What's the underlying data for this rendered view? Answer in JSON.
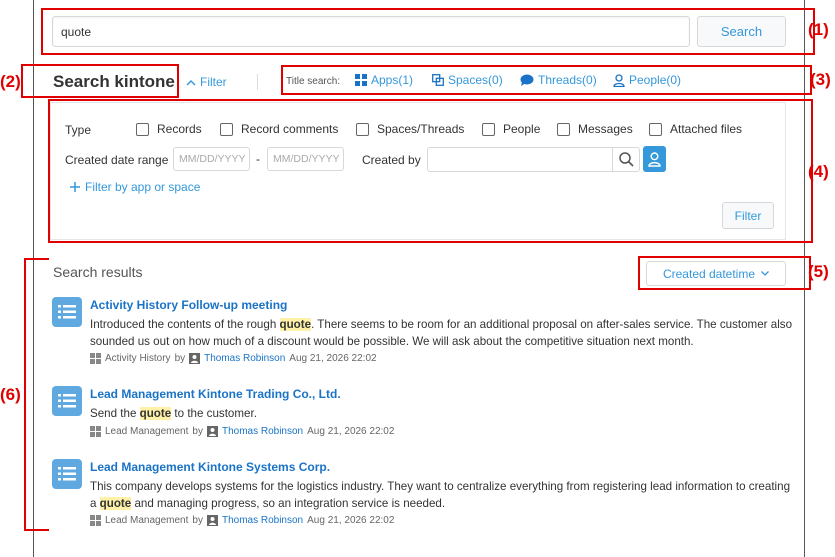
{
  "search": {
    "value": "quote",
    "button": "Search"
  },
  "header": {
    "title": "Search kintone",
    "filter_toggle": "Filter",
    "title_search_label": "Title search:",
    "links": [
      {
        "label": "Apps(1)",
        "icon": "apps-icon"
      },
      {
        "label": "Spaces(0)",
        "icon": "spaces-icon"
      },
      {
        "label": "Threads(0)",
        "icon": "threads-icon"
      },
      {
        "label": "People(0)",
        "icon": "people-icon"
      }
    ]
  },
  "filters": {
    "type_label": "Type",
    "types": [
      "Records",
      "Record comments",
      "Spaces/Threads",
      "People",
      "Messages",
      "Attached files"
    ],
    "date_label": "Created date range",
    "date_from_placeholder": "MM/DD/YYYY",
    "date_sep": "-",
    "date_to_placeholder": "MM/DD/YYYY",
    "created_by_label": "Created by",
    "add_filter": "Filter by app or space",
    "apply": "Filter"
  },
  "results": {
    "heading": "Search results",
    "sort": "Created datetime",
    "items": [
      {
        "title": "Activity History Follow-up meeting",
        "body_before": "Introduced the contents of the rough ",
        "highlight": "quote",
        "body_after": ". There seems to be room for an additional proposal on after-sales service. The customer also sounded us out on how much of a discount would be possible. We will ask about the competitive situation next month.",
        "app": "Activity History",
        "by": "by",
        "user": "Thomas Robinson",
        "date": "Aug 21, 2026 22:02"
      },
      {
        "title": "Lead Management Kintone Trading Co., Ltd.",
        "body_before": "Send the ",
        "highlight": "quote",
        "body_after": " to the customer.",
        "app": "Lead Management",
        "by": "by",
        "user": "Thomas Robinson",
        "date": "Aug 21, 2026 22:02"
      },
      {
        "title": "Lead Management Kintone Systems Corp.",
        "body_before": "This company develops systems for the logistics industry. They want to centralize everything from registering lead information to creating a ",
        "highlight": "quote",
        "body_after": " and managing progress, so an integration service is needed.",
        "app": "Lead Management",
        "by": "by",
        "user": "Thomas Robinson",
        "date": "Aug 21, 2026 22:02"
      }
    ]
  },
  "annotations": [
    "(1)",
    "(2)",
    "(3)",
    "(4)",
    "(5)",
    "(6)"
  ],
  "colors": {
    "accent": "#3498db",
    "annotation": "#e00000",
    "highlight": "#fff2a8"
  }
}
